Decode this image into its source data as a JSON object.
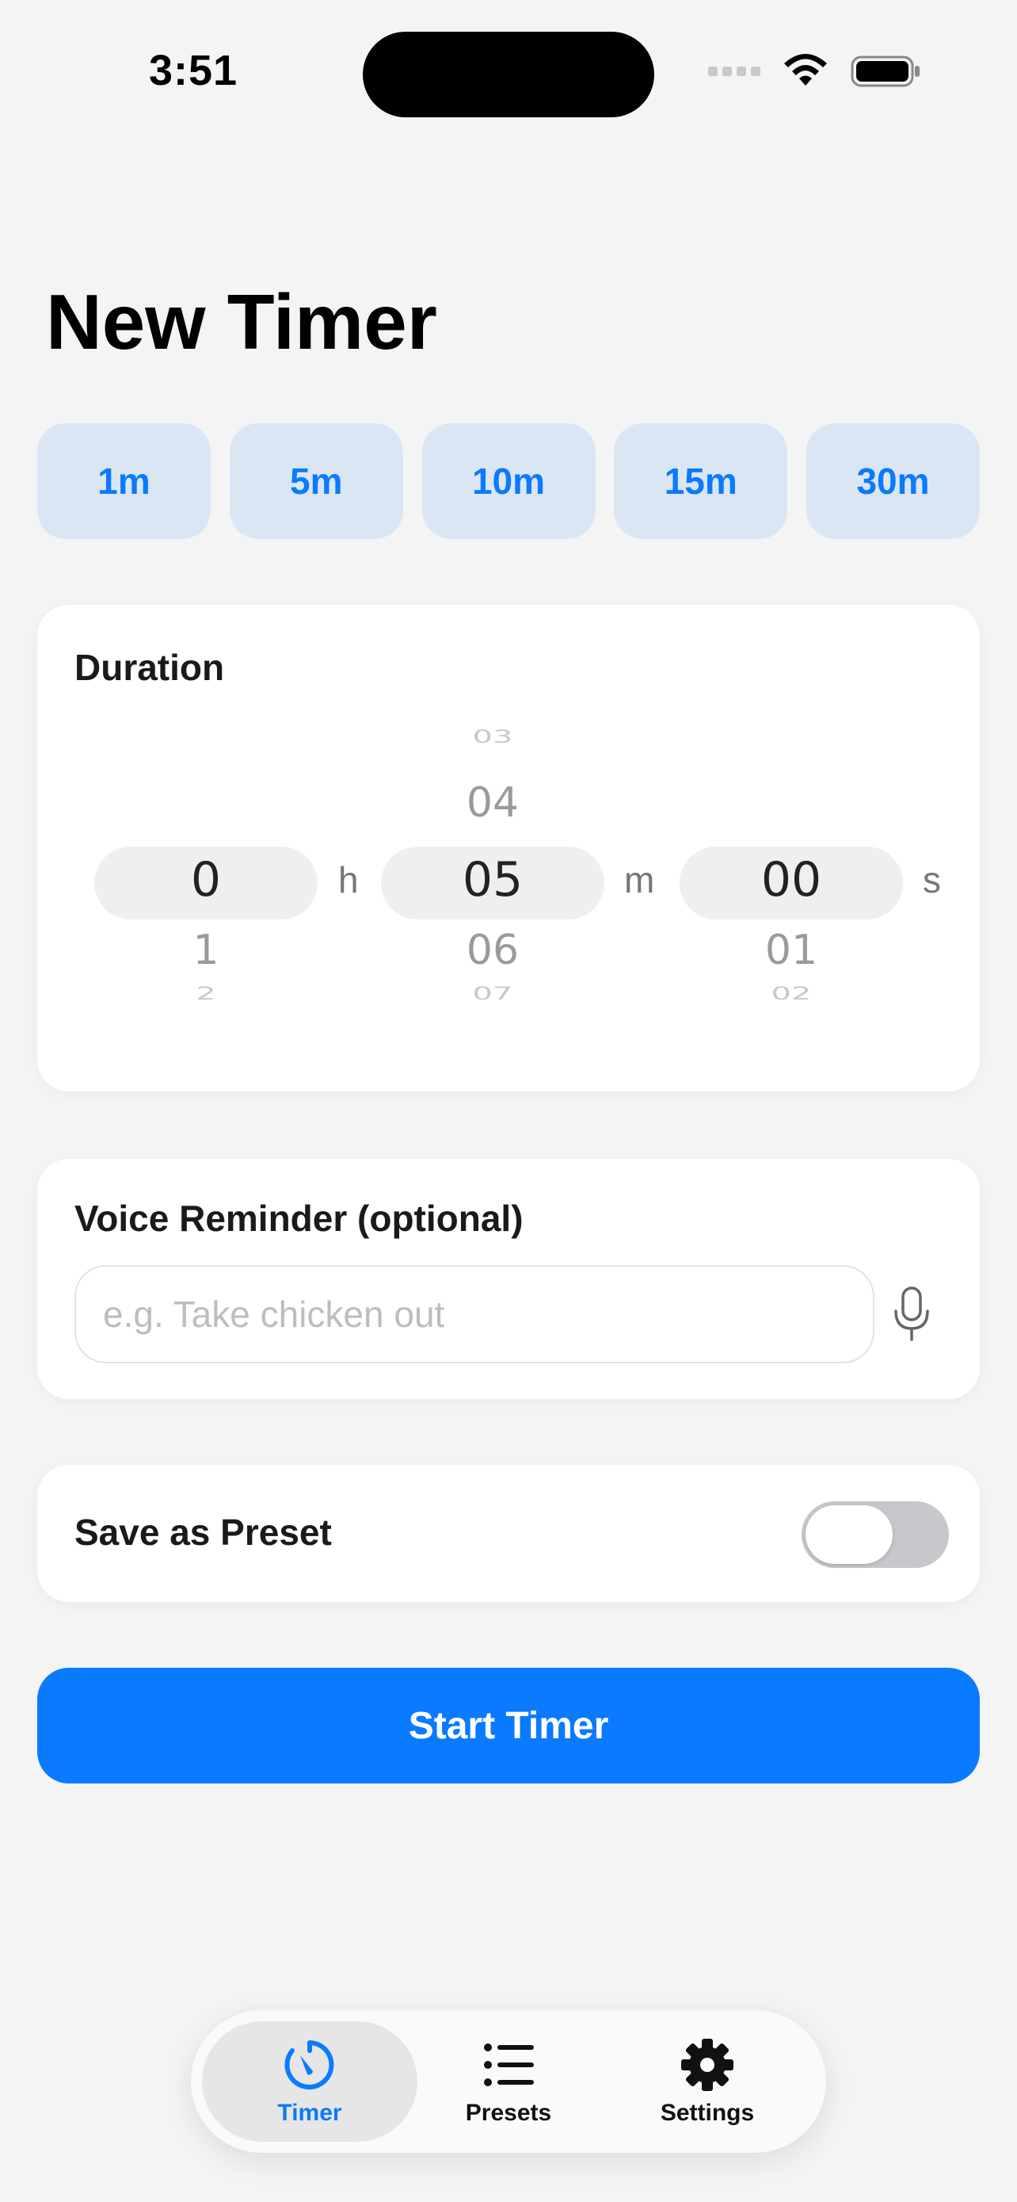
{
  "status_bar": {
    "time": "3:51"
  },
  "title": "New Timer",
  "quick_durations": [
    "1m",
    "5m",
    "10m",
    "15m",
    "30m"
  ],
  "duration": {
    "label": "Duration",
    "hours": {
      "above_far": "",
      "above": "",
      "selected": "0",
      "below": "1",
      "below_far": "2",
      "unit": "h"
    },
    "minutes": {
      "above_far": "03",
      "above": "04",
      "selected": "05",
      "below": "06",
      "below_far": "07",
      "unit": "m"
    },
    "seconds": {
      "above_far": "",
      "above": "",
      "selected": "00",
      "below": "01",
      "below_far": "02",
      "unit": "s"
    }
  },
  "voice": {
    "label": "Voice Reminder (optional)",
    "placeholder": "e.g. Take chicken out",
    "value": ""
  },
  "preset": {
    "label": "Save as Preset",
    "enabled": false
  },
  "start_button": "Start Timer",
  "tabs": [
    {
      "label": "Timer",
      "icon": "timer-icon",
      "active": true
    },
    {
      "label": "Presets",
      "icon": "list-icon",
      "active": false
    },
    {
      "label": "Settings",
      "icon": "gear-icon",
      "active": false
    }
  ],
  "colors": {
    "accent": "#0a7aff",
    "quick_bg": "#dbe6f5",
    "background": "#f4f4f4"
  }
}
